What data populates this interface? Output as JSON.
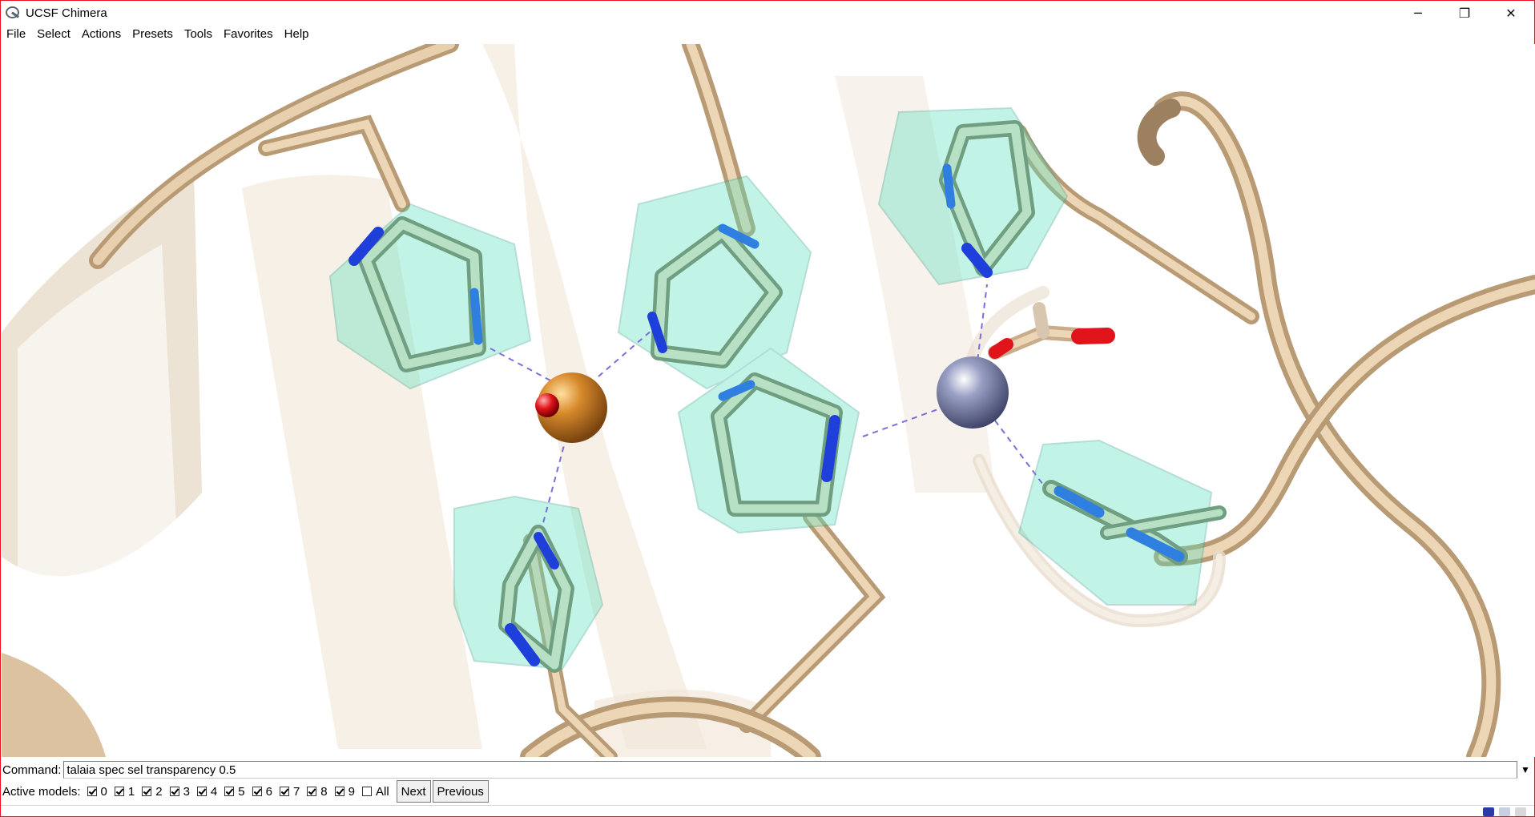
{
  "app": {
    "title": "UCSF Chimera"
  },
  "window_controls": {
    "minimize": "─",
    "maximize": "❐",
    "close": "✕"
  },
  "menu": [
    {
      "label": "File"
    },
    {
      "label": "Select"
    },
    {
      "label": "Actions"
    },
    {
      "label": "Presets"
    },
    {
      "label": "Tools"
    },
    {
      "label": "Favorites"
    },
    {
      "label": "Help"
    }
  ],
  "command": {
    "label": "Command:",
    "value": "talaia spec sel transparency 0.5",
    "dropdown": "▼"
  },
  "models": {
    "label": "Active models:",
    "items": [
      {
        "label": "0",
        "checked": true
      },
      {
        "label": "1",
        "checked": true
      },
      {
        "label": "2",
        "checked": true
      },
      {
        "label": "3",
        "checked": true
      },
      {
        "label": "4",
        "checked": true
      },
      {
        "label": "5",
        "checked": true
      },
      {
        "label": "6",
        "checked": true
      },
      {
        "label": "7",
        "checked": true
      },
      {
        "label": "8",
        "checked": true
      },
      {
        "label": "9",
        "checked": true
      },
      {
        "label": "All",
        "checked": false
      }
    ],
    "next_label": "Next",
    "previous_label": "Previous"
  },
  "colors": {
    "ribbon": "#d8bc96",
    "ring_carbon": "#a9d3b4",
    "nitrogen": "#1e3fd9",
    "oxygen": "#e0141a",
    "iron": "#c57a26",
    "zinc": "#8a8fb0",
    "polyhedron": "#6fe3c6",
    "contact": "#7a6fd8"
  }
}
